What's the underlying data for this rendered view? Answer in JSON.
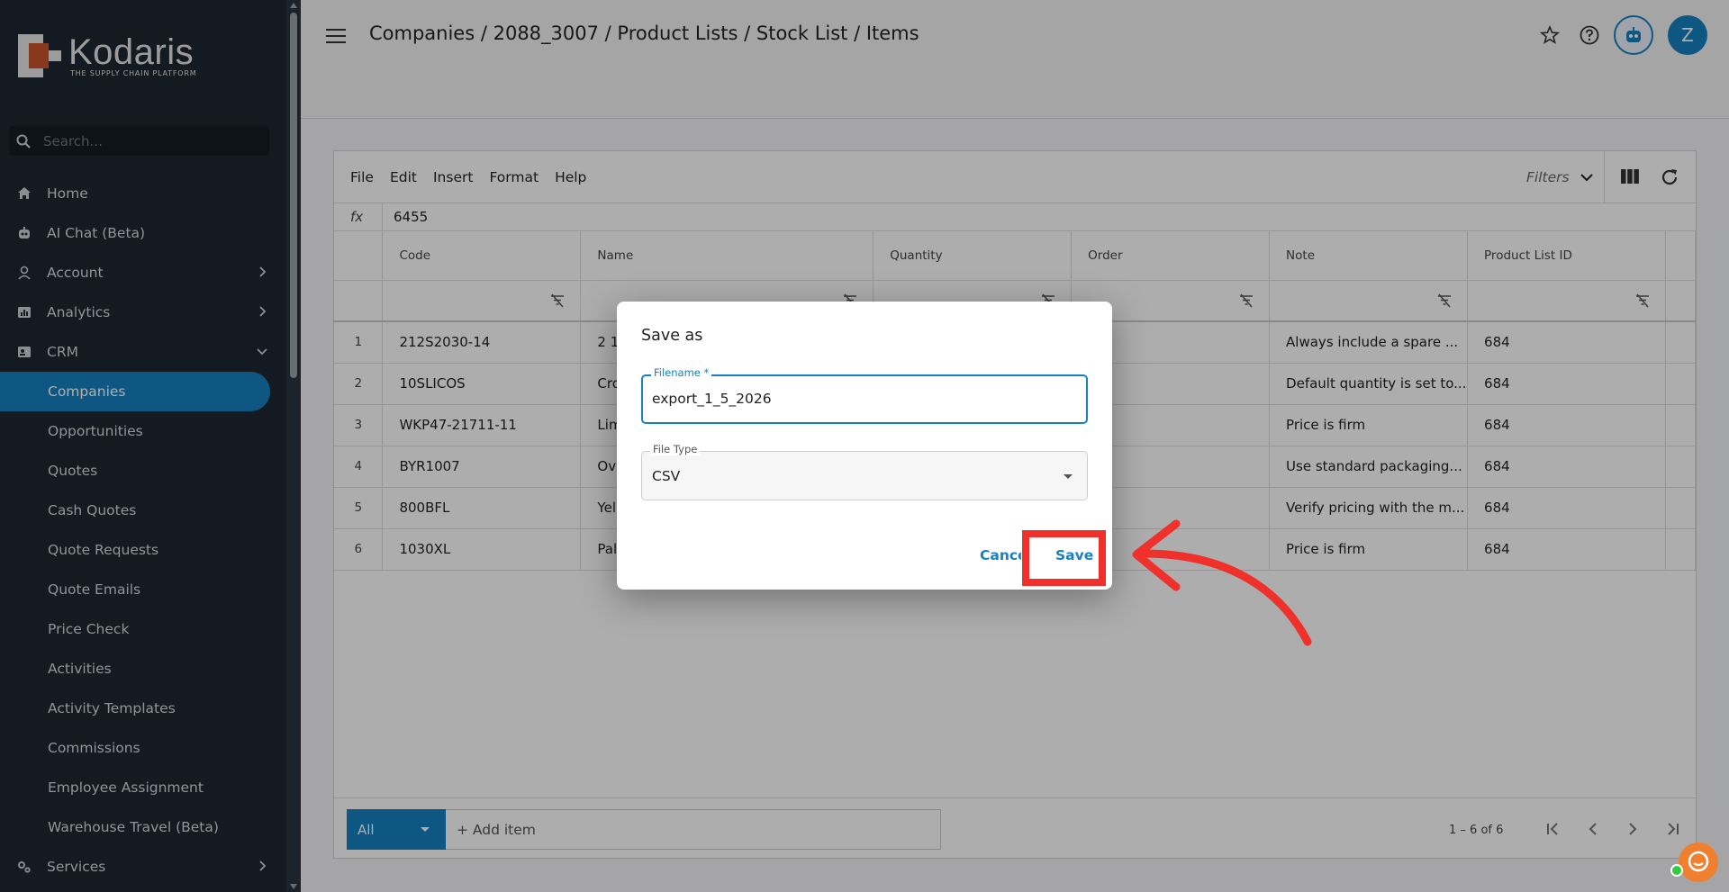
{
  "brand": {
    "name": "Kodaris",
    "tagline": "THE SUPPLY CHAIN PLATFORM",
    "accent": "#1781c2"
  },
  "sidebar": {
    "search_placeholder": "Search...",
    "items": [
      {
        "label": "Home",
        "icon": "home-icon"
      },
      {
        "label": "AI Chat (Beta)",
        "icon": "robot-icon"
      },
      {
        "label": "Account",
        "icon": "person-icon"
      },
      {
        "label": "Analytics",
        "icon": "chart-icon"
      },
      {
        "label": "CRM",
        "icon": "crm-icon"
      }
    ],
    "crm_items": [
      "Companies",
      "Opportunities",
      "Quotes",
      "Cash Quotes",
      "Quote Requests",
      "Quote Emails",
      "Price Check",
      "Activities",
      "Activity Templates",
      "Commissions",
      "Employee Assignment",
      "Warehouse Travel (Beta)"
    ],
    "services": {
      "label": "Services",
      "icon": "services-icon"
    }
  },
  "header": {
    "breadcrumb": "Companies / 2088_3007 / Product Lists / Stock List / Items",
    "avatar_initial": "Z"
  },
  "toolbar": {
    "menu": [
      "File",
      "Edit",
      "Insert",
      "Format",
      "Help"
    ],
    "filters_label": "Filters"
  },
  "formula": {
    "label": "fx",
    "value": "6455"
  },
  "grid": {
    "columns": [
      "Code",
      "Name",
      "Quantity",
      "Order",
      "Note",
      "Product List ID"
    ],
    "rows": [
      {
        "n": "1",
        "code": "212S2030-14",
        "name": "2 1",
        "note": "Always include a spare ...",
        "plid": "684"
      },
      {
        "n": "2",
        "code": "10SLICOS",
        "name": "Cro",
        "note": "Default quantity is set to...",
        "plid": "684"
      },
      {
        "n": "3",
        "code": "WKP47-21711-11",
        "name": "Lim",
        "note": "Price is firm",
        "plid": "684"
      },
      {
        "n": "4",
        "code": "BYR1007",
        "name": "Ov",
        "note": "Use standard packaging...",
        "plid": "684"
      },
      {
        "n": "5",
        "code": "800BFL",
        "name": "Yel",
        "note": "Verify pricing with the m...",
        "plid": "684"
      },
      {
        "n": "6",
        "code": "1030XL",
        "name": "Pal",
        "note": "Price is firm",
        "plid": "684"
      }
    ]
  },
  "footer": {
    "select_value": "All",
    "add_item": "+ Add item",
    "pager": "1 – 6 of 6"
  },
  "dialog": {
    "title": "Save as",
    "filename_label": "Filename *",
    "filename_value": "export_1_5_2026",
    "filetype_label": "File Type",
    "filetype_value": "CSV",
    "cancel_label": "Cancel",
    "save_label": "Save"
  }
}
